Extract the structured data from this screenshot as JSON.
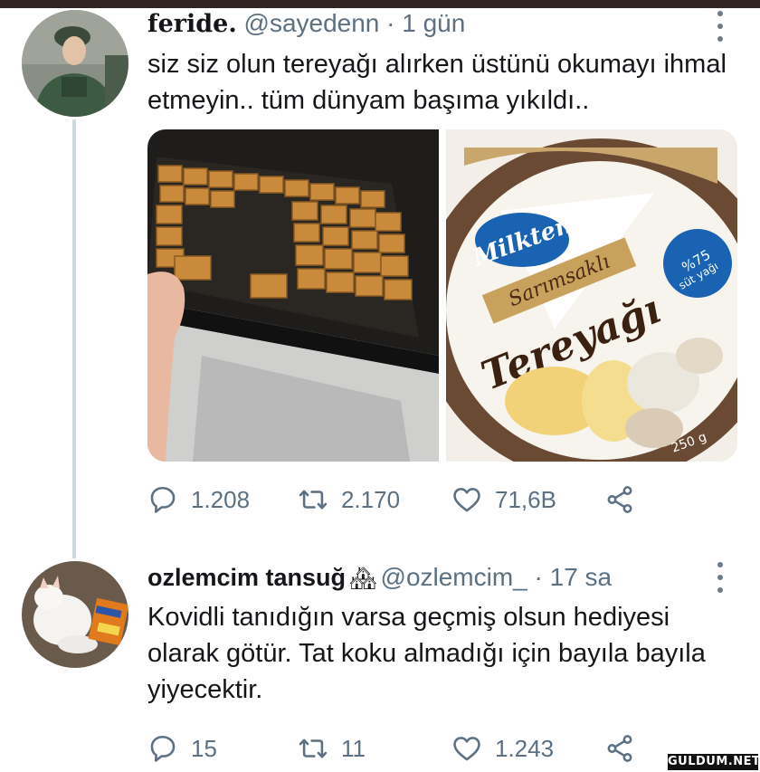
{
  "tweets": [
    {
      "display_name": "feride.",
      "handle": "@sayedenn",
      "time": "· 1 gün",
      "text": "siz siz olun tereyağı alırken üstünü okumayı ihmal etmeyin.. tüm dünyam başıma yıkıldı..",
      "images": [
        {
          "icon": "baklava-tray-photo"
        },
        {
          "icon": "butter-package-photo",
          "brand": "Milkten",
          "subtitle": "Sarımsaklı",
          "product": "Tereyağı",
          "badge_line1": "%75",
          "badge_line2": "süt yağı",
          "weight": "250 g"
        }
      ],
      "stats": {
        "replies": "1.208",
        "retweets": "2.170",
        "likes": "71,6B"
      }
    },
    {
      "display_name": "ozlemcim tansuğ",
      "name_emoji": "🏘",
      "handle": "@ozlemcim_",
      "time": "· 17 sa",
      "text": "Kovidli tanıdığın varsa geçmiş olsun hediyesi olarak götür. Tat koku almadığı için bayıla bayıla yiyecektir.",
      "stats": {
        "replies": "15",
        "retweets": "11",
        "likes": "1.243"
      }
    }
  ],
  "watermark": "GULDUM.NET",
  "colors": {
    "text": "#141619",
    "muted": "#5b7083",
    "thread_line": "#cfd9de",
    "top_bar": "#2f2422"
  }
}
